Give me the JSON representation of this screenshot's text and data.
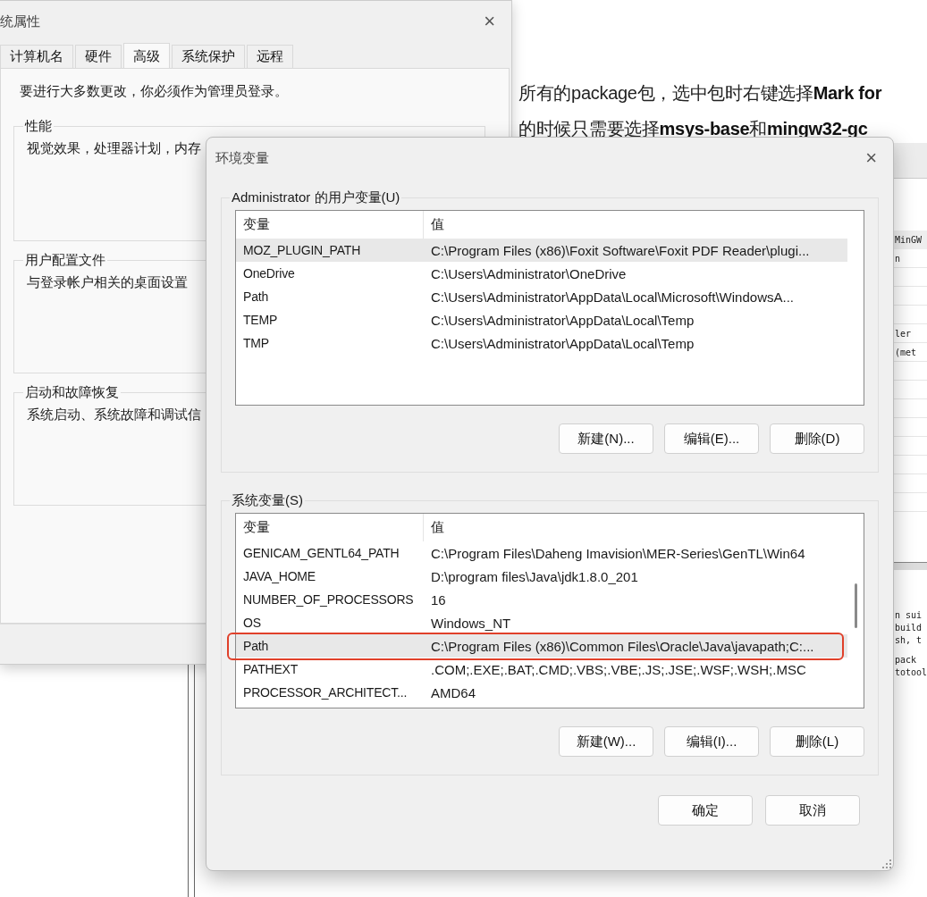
{
  "blog": {
    "lines": [
      "所有的package包，选中包时右键选择**Mark for**",
      "的时候只需要选择**msys-base**和**mingw32-gc**"
    ]
  },
  "installer": {
    "header": "MinGW",
    "rows": [
      "n",
      "ler",
      "(met"
    ],
    "description": [
      "n sui",
      "build",
      "sh, t",
      "pack",
      "totool"
    ]
  },
  "system_properties": {
    "title": "统属性",
    "tabs": [
      {
        "label": "计算机名",
        "selected": false
      },
      {
        "label": "硬件",
        "selected": false
      },
      {
        "label": "高级",
        "selected": true
      },
      {
        "label": "系统保护",
        "selected": false
      },
      {
        "label": "远程",
        "selected": false
      }
    ],
    "notice": "要进行大多数更改，你必须作为管理员登录。",
    "groups": [
      {
        "title": "性能",
        "text": "视觉效果，处理器计划，内存"
      },
      {
        "title": "用户配置文件",
        "text": "与登录帐户相关的桌面设置"
      },
      {
        "title": "启动和故障恢复",
        "text": "系统启动、系统故障和调试信"
      }
    ]
  },
  "environment_variables": {
    "title": "环境变量",
    "close": "×",
    "user_variables": {
      "title": "Administrator 的用户变量(U)",
      "columns": [
        "变量",
        "值"
      ],
      "rows": [
        {
          "name": "MOZ_PLUGIN_PATH",
          "value": "C:\\Program Files (x86)\\Foxit Software\\Foxit PDF Reader\\plugi...",
          "selected": true
        },
        {
          "name": "OneDrive",
          "value": "C:\\Users\\Administrator\\OneDrive",
          "selected": false
        },
        {
          "name": "Path",
          "value": "C:\\Users\\Administrator\\AppData\\Local\\Microsoft\\WindowsA...",
          "selected": false
        },
        {
          "name": "TEMP",
          "value": "C:\\Users\\Administrator\\AppData\\Local\\Temp",
          "selected": false
        },
        {
          "name": "TMP",
          "value": "C:\\Users\\Administrator\\AppData\\Local\\Temp",
          "selected": false
        }
      ],
      "buttons": [
        "新建(N)...",
        "编辑(E)...",
        "删除(D)"
      ]
    },
    "system_variables": {
      "title": "系统变量(S)",
      "columns": [
        "变量",
        "值"
      ],
      "rows": [
        {
          "name": "GENICAM_GENTL64_PATH",
          "value": "C:\\Program Files\\Daheng Imavision\\MER-Series\\GenTL\\Win64",
          "selected": false,
          "annotated": false
        },
        {
          "name": "JAVA_HOME",
          "value": "D:\\program files\\Java\\jdk1.8.0_201",
          "selected": false,
          "annotated": false
        },
        {
          "name": "NUMBER_OF_PROCESSORS",
          "value": "16",
          "selected": false,
          "annotated": false
        },
        {
          "name": "OS",
          "value": "Windows_NT",
          "selected": false,
          "annotated": false
        },
        {
          "name": "Path",
          "value": "C:\\Program Files (x86)\\Common Files\\Oracle\\Java\\javapath;C:...",
          "selected": true,
          "annotated": true
        },
        {
          "name": "PATHEXT",
          "value": ".COM;.EXE;.BAT;.CMD;.VBS;.VBE;.JS;.JSE;.WSF;.WSH;.MSC",
          "selected": false,
          "annotated": false
        },
        {
          "name": "PROCESSOR_ARCHITECT...",
          "value": "AMD64",
          "selected": false,
          "annotated": false
        }
      ],
      "buttons": [
        "新建(W)...",
        "编辑(I)...",
        "删除(L)"
      ]
    },
    "dialog_buttons": [
      "确定",
      "取消"
    ]
  }
}
